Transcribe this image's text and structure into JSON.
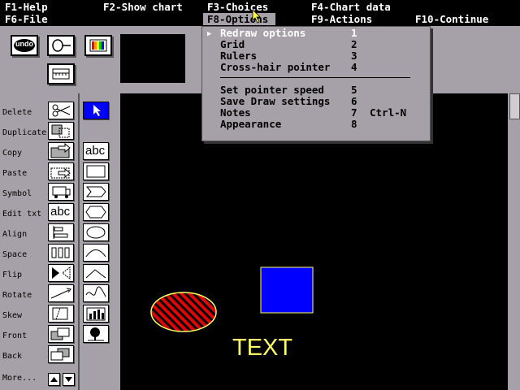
{
  "menubar": {
    "items": [
      {
        "label": "F1-Help"
      },
      {
        "label": "F2-Show chart"
      },
      {
        "label": "F3-Choices"
      },
      {
        "label": "F4-Chart data"
      },
      {
        "label": "F6-File"
      },
      {
        "label": "F8-Options"
      },
      {
        "label": "F9-Actions"
      },
      {
        "label": "F10-Continue"
      }
    ]
  },
  "toolbar": {
    "undo_label": "undo"
  },
  "tools": [
    {
      "label": "Delete"
    },
    {
      "label": "Duplicate"
    },
    {
      "label": "Copy"
    },
    {
      "label": "Paste"
    },
    {
      "label": "Symbol"
    },
    {
      "label": "Edit txt"
    },
    {
      "label": "Align"
    },
    {
      "label": "Space"
    },
    {
      "label": "Flip"
    },
    {
      "label": "Rotate"
    },
    {
      "label": "Skew"
    },
    {
      "label": "Front"
    },
    {
      "label": "Back"
    },
    {
      "label": "More..."
    }
  ],
  "edit_text_icon": "abc",
  "text_tool_icon": "abc",
  "options_menu": {
    "items": [
      {
        "label": "Redraw options",
        "num": "1",
        "key": ""
      },
      {
        "label": "Grid",
        "num": "2",
        "key": ""
      },
      {
        "label": "Rulers",
        "num": "3",
        "key": ""
      },
      {
        "label": "Cross-hair pointer",
        "num": "4",
        "key": ""
      },
      {
        "label": "Set pointer speed",
        "num": "5",
        "key": ""
      },
      {
        "label": "Save Draw settings",
        "num": "6",
        "key": ""
      },
      {
        "label": "Notes",
        "num": "7",
        "key": "Ctrl-N"
      },
      {
        "label": "Appearance",
        "num": "8",
        "key": ""
      }
    ]
  },
  "canvas": {
    "text_object": "TEXT",
    "colors": {
      "square_fill": "#0000ff",
      "ellipse_fill": "#e00000",
      "ellipse_stripe": "#000000",
      "outline": "#ffff66"
    }
  }
}
